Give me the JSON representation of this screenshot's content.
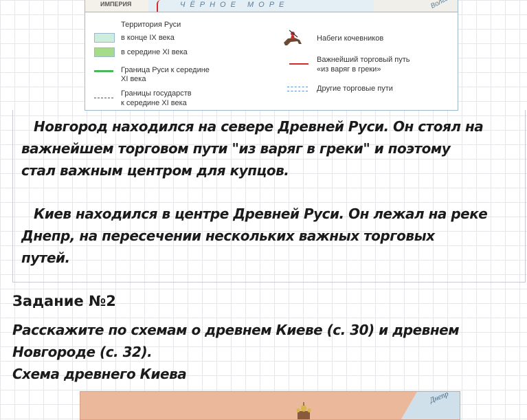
{
  "map_legend": {
    "empire_label": "ИМПЕРИЯ",
    "sea_label": "ЧЁРНОЕ МОРЕ",
    "river_label": "Волга",
    "territory_title": "Территория Руси",
    "territory_ix": "в конце IX века",
    "territory_xi": "в середине XI века",
    "border_rus_line1": "Граница Руси к середине",
    "border_rus_line2": "XI века",
    "borders_states_line1": "Границы государств",
    "borders_states_line2": "к середине XI века",
    "nomad_raids": "Набеги кочевников",
    "main_route_line1": "Важнейший торговый путь",
    "main_route_line2": "«из варяг в греки»",
    "other_routes": "Другие торговые пути",
    "colors": {
      "territory_ix": "#cdeedd",
      "territory_xi": "#a6db8a",
      "border_rus": "#4ab85a",
      "main_route": "#d32b2b",
      "other_routes": "#5b8fd0"
    }
  },
  "paragraphs": {
    "novgorod_line1": "Новгород находился на севере Древней Руси. Он стоял на",
    "novgorod_line2": "важнейшем торговом пути \"из варяг в греки\" и поэтому",
    "novgorod_line3": "стал важным центром для купцов.",
    "kiev_line1": "Киев находился в центре Древней Руси. Он лежал на реке",
    "kiev_line2": "Днепр, на пересечении нескольких важных торговых",
    "kiev_line3": "путей."
  },
  "task": {
    "heading": "Задание №2",
    "body_line1": "Расскажите по схемам о древнем Киеве (с. 30) и древнем",
    "body_line2": "Новгороде (с. 32).",
    "scheme_title": "Схема древнего Киева"
  },
  "scheme": {
    "river_label": "Днепр"
  }
}
